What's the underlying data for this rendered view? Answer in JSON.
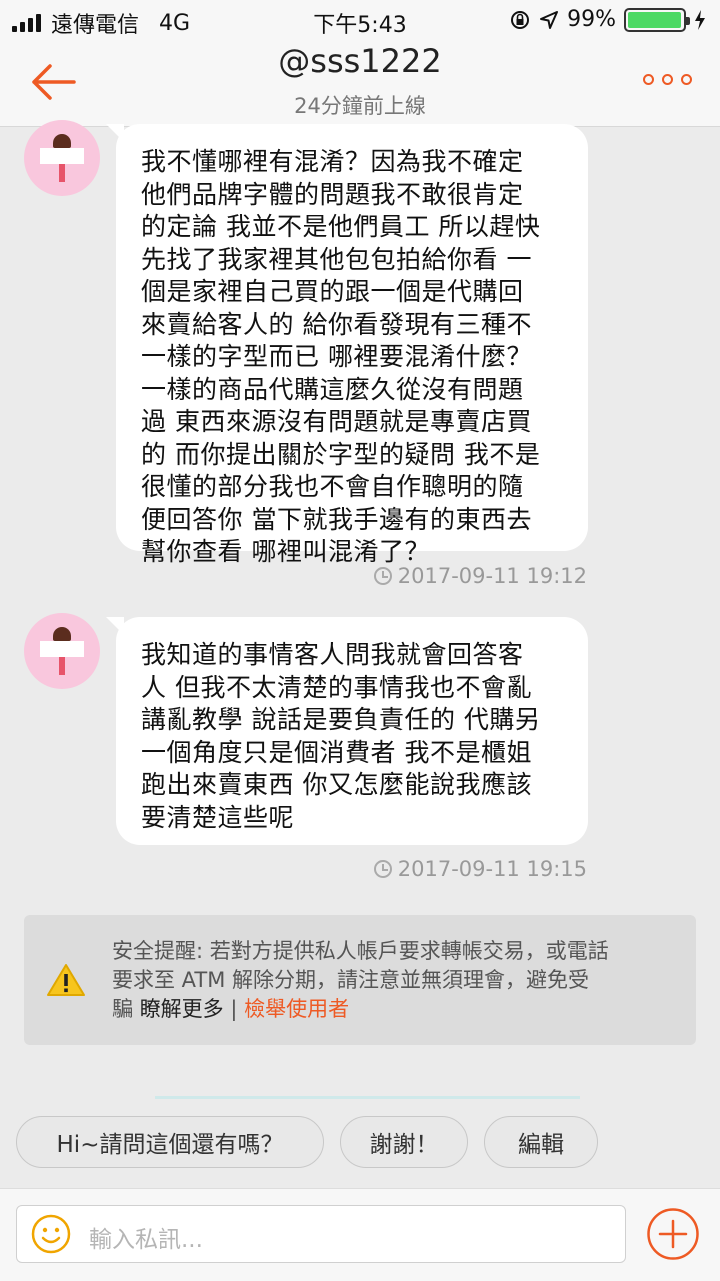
{
  "status_bar": {
    "carrier": "遠傳電信",
    "network": "4G",
    "time": "下午5:43",
    "battery": "99%",
    "battery_level": 0.99
  },
  "header": {
    "title": "@sss1222",
    "subtitle": "24分鐘前上線",
    "accent_color": "#ee5a24"
  },
  "messages": [
    {
      "lines": [
        "我不懂哪裡有混淆？因為我不確定",
        "他們品牌字體的問題我不敢很肯定",
        "的定論 我並不是他們員工 所以趕快",
        "先找了我家裡其他包包拍給你看 一",
        "個是家裡自己買的跟一個是代購回",
        "來賣給客人的 給你看發現有三種不",
        "一樣的字型而已 哪裡要混淆什麼？",
        "一樣的商品代購這麼久從沒有問題",
        "過 東西來源沒有問題就是專賣店買",
        "的 而你提出關於字型的疑問 我不是",
        "很懂的部分我也不會自作聰明的隨",
        "便回答你 當下就我手邊有的東西去",
        "幫你查看 哪裡叫混淆了？"
      ],
      "timestamp": "2017-09-11 19:12"
    },
    {
      "lines": [
        "我知道的事情客人問我就會回答客",
        "人 但我不太清楚的事情我也不會亂",
        "講亂教學 說話是要負責任的 代購另",
        "一個角度只是個消費者 我不是櫃姐",
        "跑出來賣東西 你又怎麼能說我應該",
        "要清楚這些呢"
      ],
      "timestamp": "2017-09-11 19:15"
    }
  ],
  "safety_notice": {
    "line1": "安全提醒: 若對方提供私人帳戶要求轉帳交易，或電話",
    "line2": "要求至 ATM 解除分期，請注意並無須理會，避免受",
    "line3_prefix": "騙 ",
    "learn_more": "瞭解更多",
    "separator": " | ",
    "report": "檢舉使用者"
  },
  "quick_replies": [
    "Hi~請問這個還有嗎？",
    "謝謝！",
    "編輯"
  ],
  "input": {
    "placeholder": "輸入私訊..."
  }
}
